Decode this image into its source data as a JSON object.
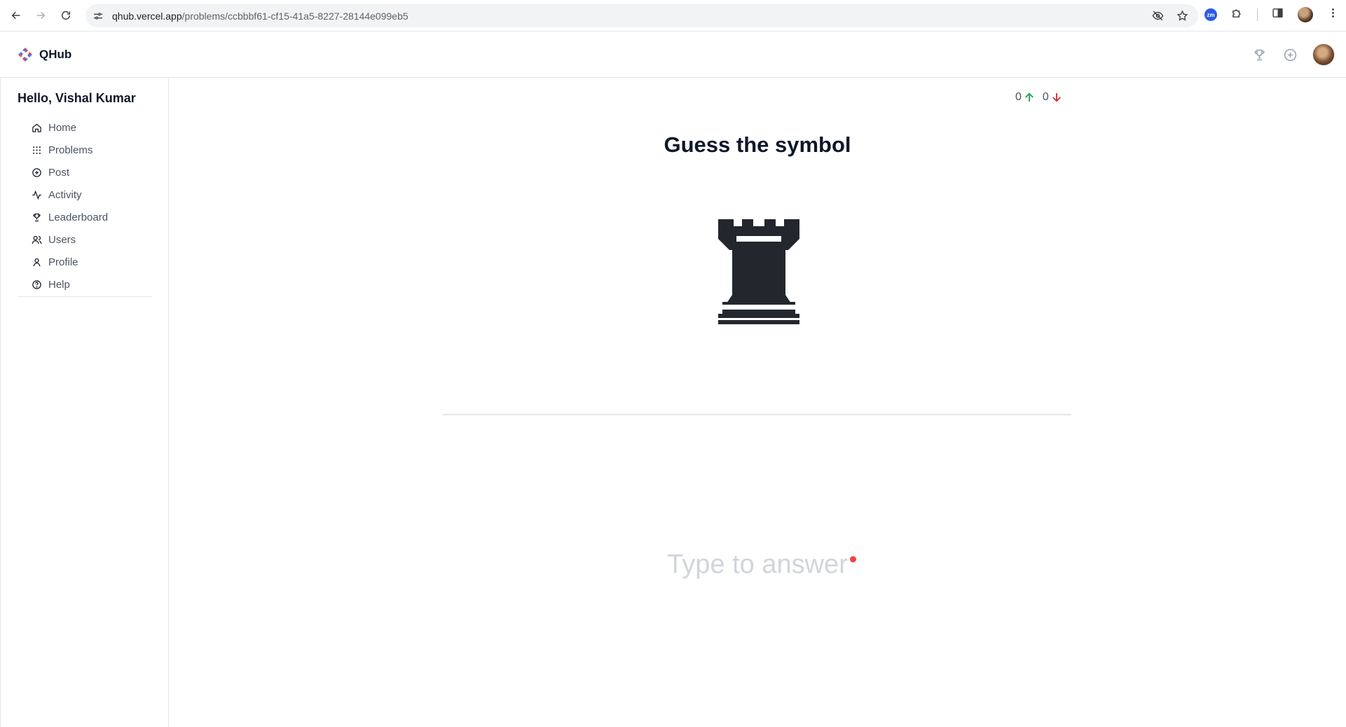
{
  "browser": {
    "url_host": "qhub.vercel.app",
    "url_path": "/problems/ccbbbf61-cf15-41a5-8227-28144e099eb5",
    "extension_badge": "zm"
  },
  "app": {
    "name": "QHub"
  },
  "sidebar": {
    "greeting": "Hello, Vishal Kumar",
    "items": [
      {
        "label": "Home",
        "icon": "home-icon"
      },
      {
        "label": "Problems",
        "icon": "grid-icon"
      },
      {
        "label": "Post",
        "icon": "plus-circle-icon"
      },
      {
        "label": "Activity",
        "icon": "activity-icon"
      },
      {
        "label": "Leaderboard",
        "icon": "trophy-icon"
      },
      {
        "label": "Users",
        "icon": "users-icon"
      },
      {
        "label": "Profile",
        "icon": "user-icon"
      },
      {
        "label": "Help",
        "icon": "help-circle-icon"
      }
    ]
  },
  "problem": {
    "upvotes": "0",
    "downvotes": "0",
    "title": "Guess the symbol",
    "symbol": "rook-icon",
    "answer_placeholder": "Type to answer",
    "answer_value": ""
  },
  "colors": {
    "upvote": "#16a34a",
    "downvote": "#dc2626",
    "required": "#ef4444"
  }
}
